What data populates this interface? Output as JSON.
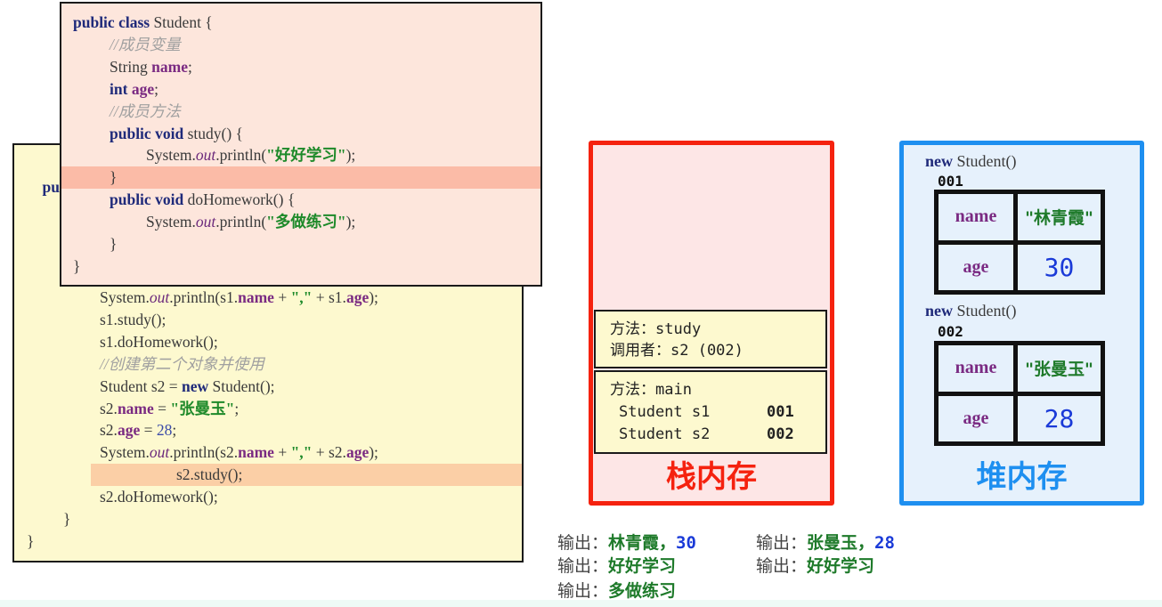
{
  "main_code": {
    "partial_header": "pub",
    "lines": [
      {
        "indent": 2,
        "segments": [
          [
            "plain",
            "System."
          ],
          [
            "static",
            "out"
          ],
          [
            "plain",
            ".println(s1."
          ],
          [
            "field",
            "name"
          ],
          [
            "plain",
            " + "
          ],
          [
            "str",
            "\",\""
          ],
          [
            "plain",
            " + s1."
          ],
          [
            "field",
            "age"
          ],
          [
            "plain",
            ");"
          ]
        ]
      },
      {
        "indent": 2,
        "segments": [
          [
            "plain",
            "s1.study();"
          ]
        ]
      },
      {
        "indent": 2,
        "segments": [
          [
            "plain",
            "s1.doHomework();"
          ]
        ]
      },
      {
        "indent": 2,
        "segments": [
          [
            "cmt",
            "//创建第二个对象并使用"
          ]
        ]
      },
      {
        "indent": 2,
        "segments": [
          [
            "plain",
            "Student s2 = "
          ],
          [
            "kw",
            "new"
          ],
          [
            "plain",
            " Student();"
          ]
        ]
      },
      {
        "indent": 2,
        "segments": [
          [
            "plain",
            "s2."
          ],
          [
            "field",
            "name"
          ],
          [
            "plain",
            " = "
          ],
          [
            "str",
            "\"张曼玉\""
          ],
          [
            "plain",
            ";"
          ]
        ]
      },
      {
        "indent": 2,
        "segments": [
          [
            "plain",
            "s2."
          ],
          [
            "field",
            "age"
          ],
          [
            "plain",
            " = "
          ],
          [
            "num",
            "28"
          ],
          [
            "plain",
            ";"
          ]
        ]
      },
      {
        "indent": 2,
        "segments": [
          [
            "plain",
            "System."
          ],
          [
            "static",
            "out"
          ],
          [
            "plain",
            ".println(s2."
          ],
          [
            "field",
            "name"
          ],
          [
            "plain",
            " + "
          ],
          [
            "str",
            "\",\""
          ],
          [
            "plain",
            " + s2."
          ],
          [
            "field",
            "age"
          ],
          [
            "plain",
            ");"
          ]
        ]
      },
      {
        "indent": 2,
        "highlight": "orange",
        "segments": [
          [
            "plain",
            "s2.study();"
          ]
        ]
      },
      {
        "indent": 2,
        "segments": [
          [
            "plain",
            "s2.doHomework();"
          ]
        ]
      },
      {
        "indent": 1,
        "segments": [
          [
            "plain",
            "}"
          ]
        ]
      },
      {
        "indent": 0,
        "segments": [
          [
            "plain",
            "}"
          ]
        ]
      }
    ]
  },
  "student_code": {
    "lines": [
      {
        "indent": 0,
        "segments": [
          [
            "kw",
            "public"
          ],
          [
            "plain",
            " "
          ],
          [
            "kw",
            "class"
          ],
          [
            "plain",
            " Student {"
          ]
        ]
      },
      {
        "indent": 1,
        "segments": [
          [
            "cmt",
            "//成员变量"
          ]
        ]
      },
      {
        "indent": 1,
        "segments": [
          [
            "plain",
            "String "
          ],
          [
            "field",
            "name"
          ],
          [
            "plain",
            ";"
          ]
        ]
      },
      {
        "indent": 1,
        "segments": [
          [
            "kw",
            "int"
          ],
          [
            "plain",
            " "
          ],
          [
            "field",
            "age"
          ],
          [
            "plain",
            ";"
          ]
        ]
      },
      {
        "indent": 1,
        "segments": [
          [
            "cmt",
            "//成员方法"
          ]
        ]
      },
      {
        "indent": 1,
        "segments": [
          [
            "kw",
            "public"
          ],
          [
            "plain",
            " "
          ],
          [
            "kw",
            "void"
          ],
          [
            "plain",
            " study() {"
          ]
        ]
      },
      {
        "indent": 2,
        "segments": [
          [
            "plain",
            "System."
          ],
          [
            "static",
            "out"
          ],
          [
            "plain",
            ".println("
          ],
          [
            "str",
            "\"好好学习\""
          ],
          [
            "plain",
            ");"
          ]
        ]
      },
      {
        "indent": 1,
        "highlight": "red",
        "segments": [
          [
            "plain",
            "}"
          ]
        ]
      },
      {
        "indent": 1,
        "segments": [
          [
            "kw",
            "public"
          ],
          [
            "plain",
            " "
          ],
          [
            "kw",
            "void"
          ],
          [
            "plain",
            " doHomework() {"
          ]
        ]
      },
      {
        "indent": 2,
        "segments": [
          [
            "plain",
            "System."
          ],
          [
            "static",
            "out"
          ],
          [
            "plain",
            ".println("
          ],
          [
            "str",
            "\"多做练习\""
          ],
          [
            "plain",
            ");"
          ]
        ]
      },
      {
        "indent": 1,
        "segments": [
          [
            "plain",
            "}"
          ]
        ]
      },
      {
        "indent": 0,
        "segments": [
          [
            "plain",
            "}"
          ]
        ]
      }
    ]
  },
  "stack": {
    "title": "栈内存",
    "frames": {
      "study": {
        "method_label": "方法：",
        "method": "study",
        "caller_label": "调用者：",
        "caller": "s2 (002)"
      },
      "main": {
        "method_label": "方法：",
        "method": "main",
        "vars": [
          {
            "decl": "Student s1",
            "ref": "001"
          },
          {
            "decl": "Student s2",
            "ref": "002"
          }
        ]
      }
    }
  },
  "heap": {
    "title": "堆内存",
    "objects": [
      {
        "new_kw": "new",
        "ctor": " Student()",
        "address": "001",
        "fields": [
          {
            "key": "name",
            "value": "\"林青霞\""
          },
          {
            "key": "age",
            "value": "30"
          }
        ]
      },
      {
        "new_kw": "new",
        "ctor": " Student()",
        "address": "002",
        "fields": [
          {
            "key": "name",
            "value": "\"张曼玉\""
          },
          {
            "key": "age",
            "value": "28"
          }
        ]
      }
    ]
  },
  "output": {
    "label": "输出：",
    "col1": [
      {
        "text": "林青霞，",
        "num": "30"
      },
      {
        "text": "好好学习"
      },
      {
        "text": "多做练习"
      }
    ],
    "col2": [
      {
        "text": "张曼玉，",
        "num": "28"
      },
      {
        "text": "好好学习"
      }
    ]
  }
}
